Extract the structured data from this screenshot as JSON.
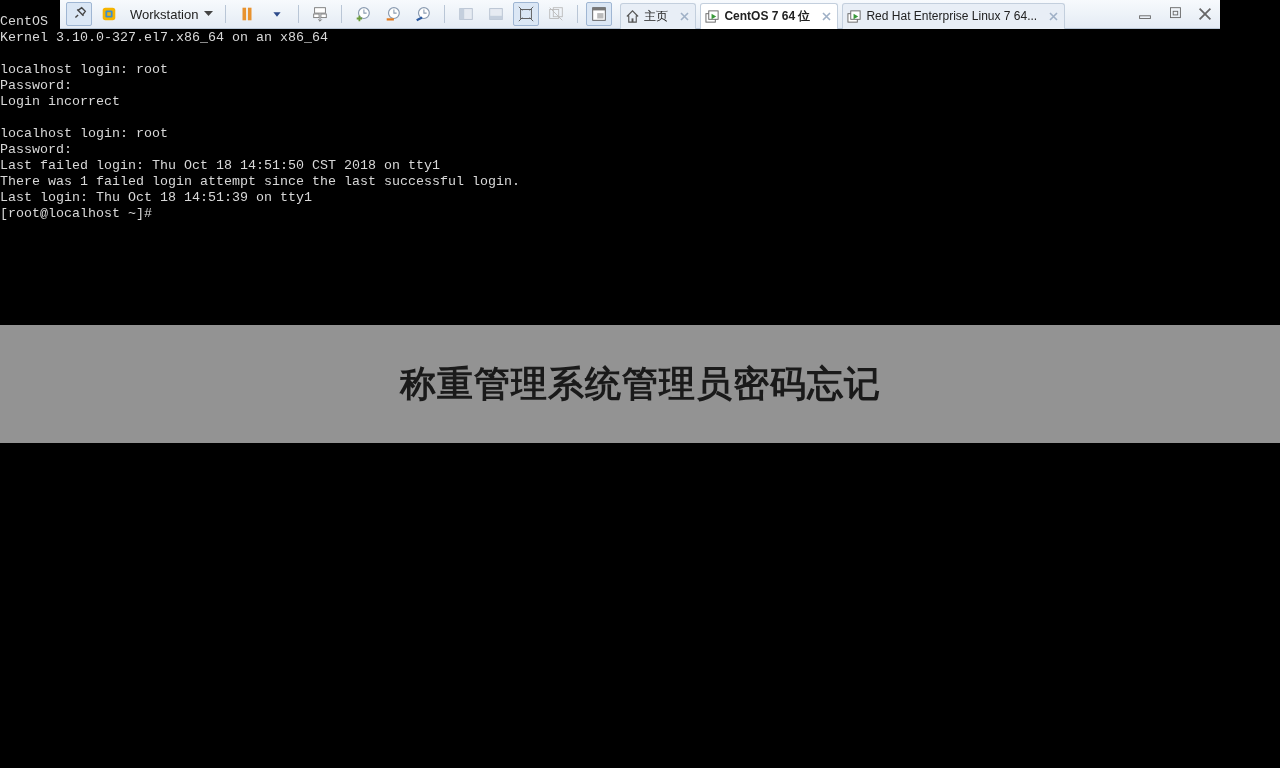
{
  "toolbar": {
    "app_menu": "Workstation",
    "tabs": [
      {
        "label": "主页",
        "kind": "home",
        "selected": false
      },
      {
        "label": "CentOS 7 64 位",
        "kind": "vm",
        "selected": true
      },
      {
        "label": "Red Hat Enterprise Linux 7 64...",
        "kind": "vm",
        "selected": false
      }
    ]
  },
  "console": {
    "blocks": [
      [
        "CentOS",
        "Kernel 3.10.0-327.el7.x86_64 on an x86_64"
      ],
      [
        "localhost login: root",
        "Password:",
        "Login incorrect"
      ],
      [
        "localhost login: root",
        "Password:",
        "Last failed login: Thu Oct 18 14:51:50 CST 2018 on tty1",
        "There was 1 failed login attempt since the last successful login.",
        "Last login: Thu Oct 18 14:51:39 on tty1",
        "[root@localhost ~]#"
      ]
    ]
  },
  "banner": {
    "title": "称重管理系统管理员密码忘记"
  }
}
